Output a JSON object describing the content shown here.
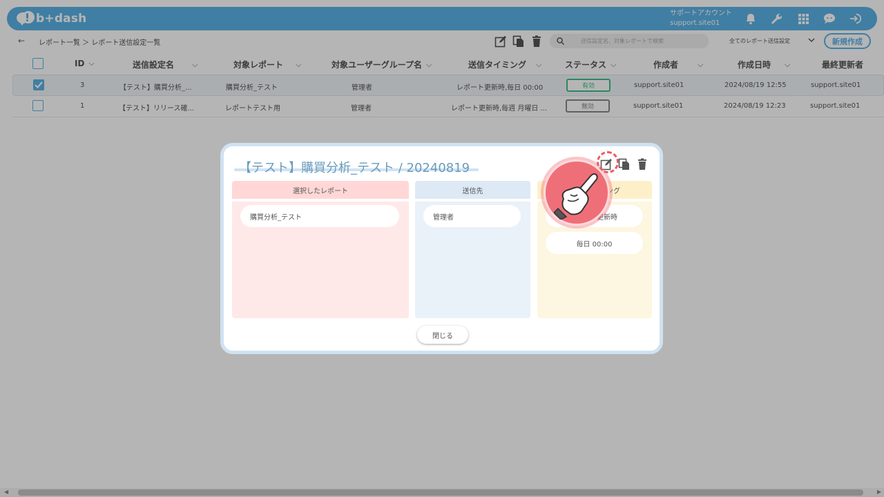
{
  "header": {
    "logo_text": "b+dash",
    "account_label": "サポートアカウント",
    "account_id": "support.site01",
    "icons": [
      "bell-icon",
      "wrench-icon",
      "grid-icon",
      "chat-icon",
      "logout-icon"
    ]
  },
  "toolbar": {
    "back_glyph": "←",
    "breadcrumb": "レポート一覧 ＞ レポート送信設定一覧",
    "search_placeholder": "送信設定名、対象レポートで検索",
    "filter_value": "全てのレポート送信設定",
    "new_button": "新規作成"
  },
  "table": {
    "columns": [
      "ID",
      "送信設定名",
      "対象レポート",
      "対象ユーザーグループ名",
      "送信タイミング",
      "ステータス",
      "作成者",
      "作成日時",
      "最終更新者"
    ],
    "rows": [
      {
        "checked": true,
        "id": "3",
        "name": "【テスト】購買分析_...",
        "report": "購買分析_テスト",
        "group": "管理者",
        "timing": "レポート更新時,毎日 00:00",
        "status": "有効",
        "creator": "support.site01",
        "created_at": "2024/08/19 12:55",
        "updater": "support.site01"
      },
      {
        "checked": false,
        "id": "1",
        "name": "【テスト】リリース確...",
        "report": "レポートテスト用",
        "group": "管理者",
        "timing": "レポート更新時,毎週 月曜日 ...",
        "status": "無効",
        "creator": "support.site01",
        "created_at": "2024/08/19 12:23",
        "updater": "support.site01"
      }
    ]
  },
  "modal": {
    "title": "【テスト】購買分析_テスト / 20240819",
    "columns": {
      "report": {
        "heading": "選択したレポート",
        "items": [
          "購買分析_テスト"
        ]
      },
      "recipient": {
        "heading": "送信先",
        "items": [
          "管理者"
        ]
      },
      "timing": {
        "heading": "ング",
        "items": [
          "更新時",
          "毎日 00:00"
        ]
      }
    },
    "close_button": "閉じる"
  },
  "colors": {
    "brand": "#5bb2e6",
    "status_active": "#3fbf87",
    "status_inactive": "#888888",
    "pointer": "#ef5a64"
  }
}
